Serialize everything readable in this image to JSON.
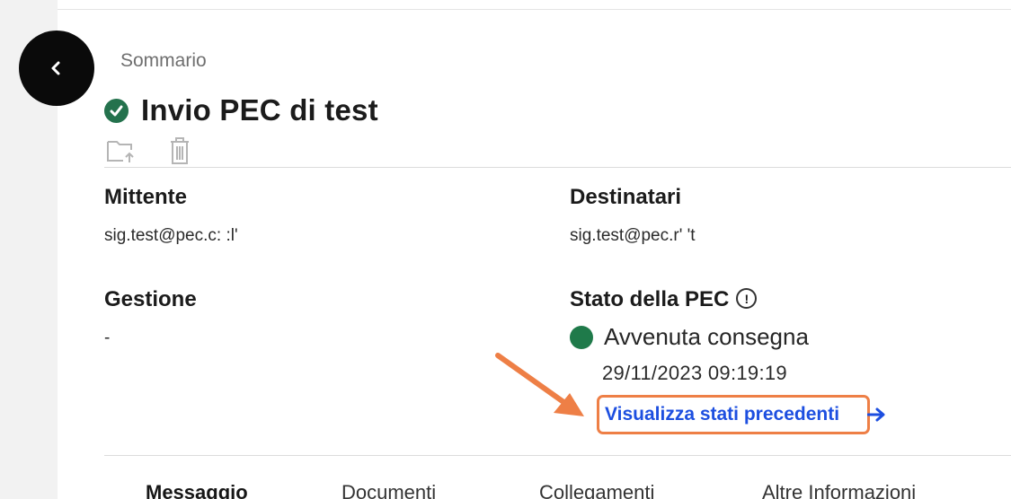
{
  "header": {
    "breadcrumb": "Sommario",
    "title": "Invio PEC di test"
  },
  "toolbar": {
    "icons": [
      "folder-move-icon",
      "trash-icon"
    ]
  },
  "details": {
    "mittente_label": "Mittente",
    "mittente_value": "sig.test@pec.c:  :l'",
    "destinatari_label": "Destinatari",
    "destinatari_value": "sig.test@pec.r'    't",
    "gestione_label": "Gestione",
    "gestione_value": "-",
    "stato_label": "Stato della PEC",
    "stato_info_glyph": "!",
    "stato_value": "Avvenuta consegna",
    "stato_date": "29/11/2023 09:19:19",
    "history_link": "Visualizza stati precedenti"
  },
  "tabs": [
    {
      "label": "Messaggio",
      "active": true
    },
    {
      "label": "Documenti",
      "active": false
    },
    {
      "label": "Collegamenti",
      "active": false
    },
    {
      "label": "Altre Informazioni",
      "active": false
    }
  ],
  "colors": {
    "status_ok": "#1f7a4a",
    "link": "#1d4fe0",
    "highlight": "#ee7f46"
  }
}
